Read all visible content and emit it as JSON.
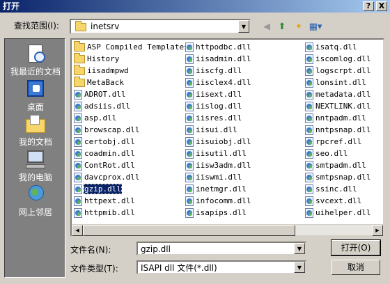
{
  "window": {
    "title": "打开",
    "help_btn": "?",
    "close_btn": "X"
  },
  "lookin": {
    "label": "查找范围(I):",
    "value": "inetsrv"
  },
  "places": [
    {
      "name": "recent",
      "label": "我最近的文档"
    },
    {
      "name": "desktop",
      "label": "桌面"
    },
    {
      "name": "mydocs",
      "label": "我的文档"
    },
    {
      "name": "mycomputer",
      "label": "我的电脑"
    },
    {
      "name": "network",
      "label": "网上邻居"
    }
  ],
  "files": {
    "col1": [
      "ASP Compiled Templates",
      "History",
      "iisadmpwd",
      "MetaBack",
      "ADROT.dll",
      "adsiis.dll",
      "asp.dll",
      "browscap.dll",
      "certobj.dll",
      "coadmin.dll",
      "ContRot.dll",
      "davcprox.dll",
      "gzip.dll",
      "httpext.dll",
      "httpmib.dll"
    ],
    "col1_types": [
      "folder",
      "folder",
      "folder",
      "folder",
      "dll",
      "dll",
      "dll",
      "dll",
      "dll",
      "dll",
      "dll",
      "dll",
      "dll",
      "dll",
      "dll"
    ],
    "col2": [
      "httpodbc.dll",
      "iisadmin.dll",
      "iiscfg.dll",
      "iisclex4.dll",
      "iisext.dll",
      "iislog.dll",
      "iisres.dll",
      "iisui.dll",
      "iisuiobj.dll",
      "iisutil.dll",
      "iisw3adm.dll",
      "iiswmi.dll",
      "inetmgr.dll",
      "infocomm.dll",
      "isapips.dll"
    ],
    "col3": [
      "isatq.dll",
      "iscomlog.dll",
      "logscrpt.dll",
      "lonsint.dll",
      "metadata.dll",
      "NEXTLINK.dll",
      "nntpadm.dll",
      "nntpsnap.dll",
      "rpcref.dll",
      "seo.dll",
      "smtpadm.dll",
      "smtpsnap.dll",
      "ssinc.dll",
      "svcext.dll",
      "uihelper.dll"
    ],
    "selected": "gzip.dll"
  },
  "filename": {
    "label": "文件名(N):",
    "value": "gzip.dll"
  },
  "filetype": {
    "label": "文件类型(T):",
    "value": "ISAPI dll 文件(*.dll)"
  },
  "buttons": {
    "open": "打开(O)",
    "cancel": "取消"
  },
  "colors": {
    "title_start": "#0a246a",
    "title_end": "#a6caf0",
    "places_bg": "#808080",
    "selection": "#0a246a"
  }
}
